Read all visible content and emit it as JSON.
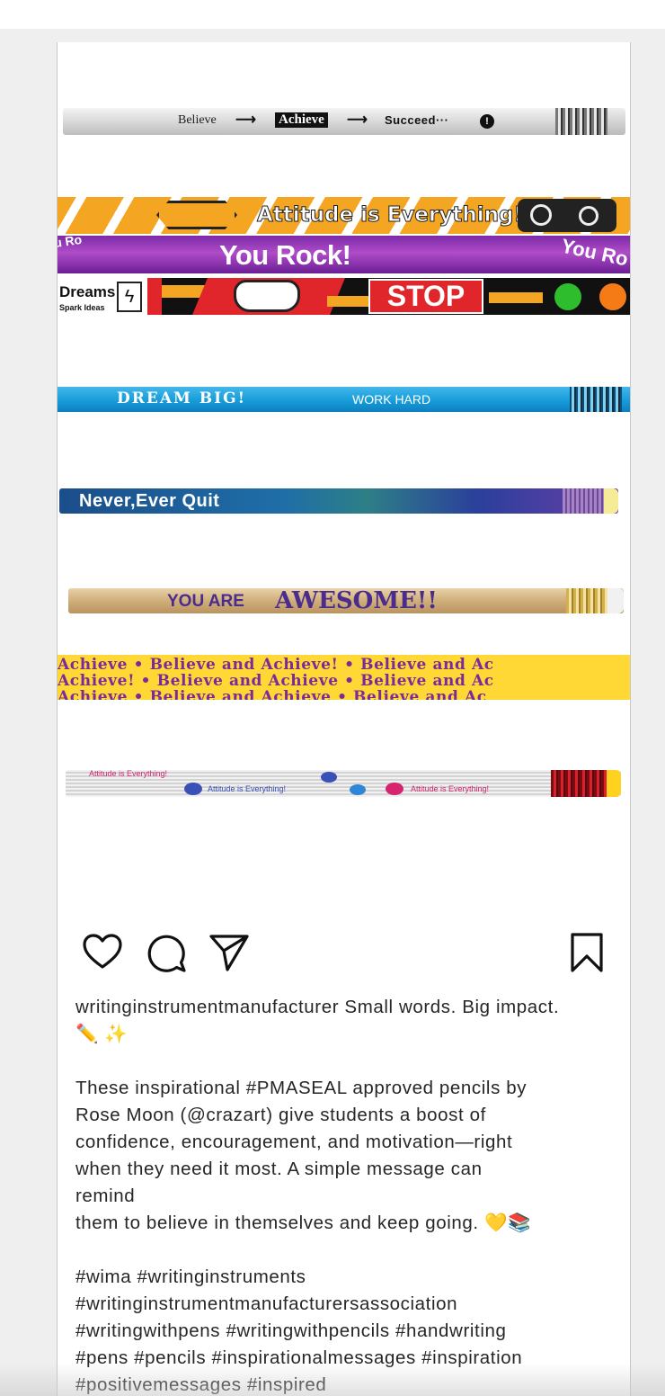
{
  "post": {
    "pencils": {
      "p1": {
        "word1": "Believe",
        "arrow1": "⟶",
        "word2": "Achieve",
        "arrow2": "⟶",
        "word3": "Succeed···"
      },
      "p2": {
        "text": "Attitude is Everything!"
      },
      "p3": {
        "text": "You Rock!",
        "text_right": "You Ro",
        "text_left": "u Ro"
      },
      "p4": {
        "text_left": "Dreams",
        "text_left_small": "Spark Ideas",
        "text": "STOP"
      },
      "p5": {
        "text": "DREAM BIG!",
        "text2": "WORK HARD"
      },
      "p6": {
        "text": "Never,Ever Quit"
      },
      "p7": {
        "text": "YOU ARE",
        "text2": "AWESOME!!"
      },
      "p8": {
        "line1": "Achieve • Believe and Achieve! • Believe and Ac",
        "line2": "Achieve! • Believe and Achieve • Believe and Ac",
        "line3": "Achieve • Believe and Achieve • Believe and Ac"
      },
      "p9": {
        "text1": "Attitude is Everything!",
        "text2": "Attitude is Everything!",
        "text3": "Attitude is Everything!"
      }
    },
    "actions": {
      "like": "heart-icon",
      "comment": "comment-icon",
      "share": "send-icon",
      "save": "bookmark-icon"
    },
    "caption": {
      "username": "writinginstrumentmanufacturer",
      "headline": "Small words. Big impact.",
      "headline_emoji": "✏️ ✨",
      "body_lines": [
        "These inspirational #PMASEAL approved pencils by",
        "Rose Moon (@crazart) give students a boost of",
        "confidence, encouragement, and motivation—right",
        "when they need it most. A simple message can",
        "remind",
        "them to believe in themselves and keep going. 💛📚"
      ],
      "hashtag_lines": [
        "#wima #writinginstruments",
        "#writinginstrumentmanufacturersassociation",
        "#writingwithpens #writingwithpencils #handwriting",
        "#pens #pencils #inspirationalmessages #inspiration",
        "#positivemessages #inspired"
      ]
    }
  },
  "colors": {
    "text": "#262626",
    "background": "#efefef",
    "card": "#ffffff"
  }
}
